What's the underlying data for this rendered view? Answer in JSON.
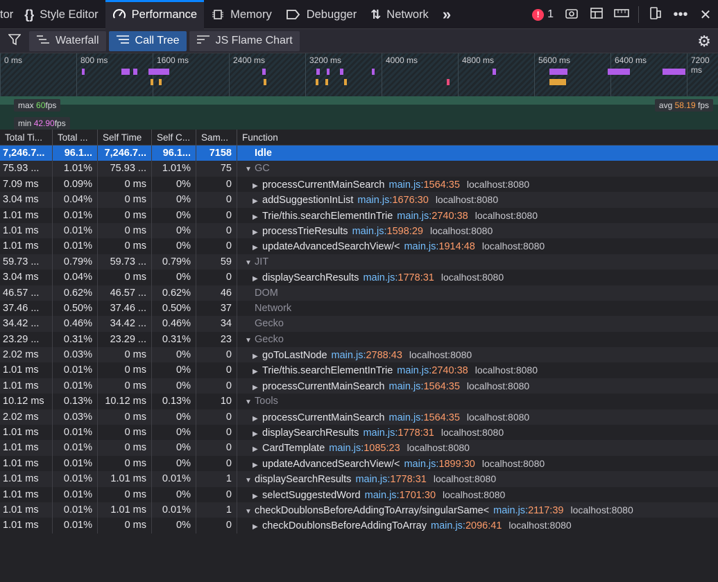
{
  "top_tabs": [
    {
      "label": "tor",
      "icon": "none"
    },
    {
      "label": "Style Editor",
      "icon": "braces-icon"
    },
    {
      "label": "Performance",
      "icon": "gauge-icon",
      "active": true
    },
    {
      "label": "Memory",
      "icon": "chip-icon"
    },
    {
      "label": "Debugger",
      "icon": "tag-icon"
    },
    {
      "label": "Network",
      "icon": "arrows-updown-icon"
    }
  ],
  "errors": {
    "count": "1"
  },
  "sub_tabs": [
    {
      "label": "Waterfall"
    },
    {
      "label": "Call Tree",
      "active": true
    },
    {
      "label": "JS Flame Chart"
    }
  ],
  "overview": {
    "ticks": [
      "0 ms",
      "800 ms",
      "1600 ms",
      "2400 ms",
      "3200 ms",
      "4000 ms",
      "4800 ms",
      "5600 ms",
      "6400 ms",
      "7200 ms"
    ],
    "fps_max_label": "max",
    "fps_max": "60",
    "fps_min_label": "min",
    "fps_min": "42.90",
    "fps_avg_label": "avg",
    "fps_avg": "58.19",
    "fps_unit": "fps"
  },
  "columns": [
    "Total Ti...",
    "Total ...",
    "Self Time",
    "Self C...",
    "Sam...",
    "Function"
  ],
  "rows": [
    {
      "total": "7,246.7...",
      "total_pct": "96.1...",
      "self": "7,246.7...",
      "self_pct": "96.1...",
      "samples": "7158",
      "name": "Idle",
      "category": true,
      "selected": true,
      "level": 0,
      "arrow": ""
    },
    {
      "total": "75.93 ...",
      "total_pct": "1.01%",
      "self": "75.93 ...",
      "self_pct": "1.01%",
      "samples": "75",
      "name": "GC",
      "category": true,
      "level": 0,
      "arrow": "▼"
    },
    {
      "total": "7.09 ms",
      "total_pct": "0.09%",
      "self": "0 ms",
      "self_pct": "0%",
      "samples": "0",
      "name": "processCurrentMainSearch",
      "file": "main.js",
      "line": "1564",
      "col": "35",
      "host": "localhost:8080",
      "level": 1,
      "arrow": "▶"
    },
    {
      "total": "3.04 ms",
      "total_pct": "0.04%",
      "self": "0 ms",
      "self_pct": "0%",
      "samples": "0",
      "name": "addSuggestionInList",
      "file": "main.js",
      "line": "1676",
      "col": "30",
      "host": "localhost:8080",
      "level": 1,
      "arrow": "▶"
    },
    {
      "total": "1.01 ms",
      "total_pct": "0.01%",
      "self": "0 ms",
      "self_pct": "0%",
      "samples": "0",
      "name": "Trie/this.searchElementInTrie",
      "file": "main.js",
      "line": "2740",
      "col": "38",
      "host": "localhost:8080",
      "level": 1,
      "arrow": "▶"
    },
    {
      "total": "1.01 ms",
      "total_pct": "0.01%",
      "self": "0 ms",
      "self_pct": "0%",
      "samples": "0",
      "name": "processTrieResults",
      "file": "main.js",
      "line": "1598",
      "col": "29",
      "host": "localhost:8080",
      "level": 1,
      "arrow": "▶"
    },
    {
      "total": "1.01 ms",
      "total_pct": "0.01%",
      "self": "0 ms",
      "self_pct": "0%",
      "samples": "0",
      "name": "updateAdvancedSearchView/<",
      "file": "main.js",
      "line": "1914",
      "col": "48",
      "host": "localhost:8080",
      "level": 1,
      "arrow": "▶"
    },
    {
      "total": "59.73 ...",
      "total_pct": "0.79%",
      "self": "59.73 ...",
      "self_pct": "0.79%",
      "samples": "59",
      "name": "JIT",
      "category": true,
      "level": 0,
      "arrow": "▼"
    },
    {
      "total": "3.04 ms",
      "total_pct": "0.04%",
      "self": "0 ms",
      "self_pct": "0%",
      "samples": "0",
      "name": "displaySearchResults",
      "file": "main.js",
      "line": "1778",
      "col": "31",
      "host": "localhost:8080",
      "level": 1,
      "arrow": "▶"
    },
    {
      "total": "46.57 ...",
      "total_pct": "0.62%",
      "self": "46.57 ...",
      "self_pct": "0.62%",
      "samples": "46",
      "name": "DOM",
      "category": true,
      "level": 0,
      "arrow": ""
    },
    {
      "total": "37.46 ...",
      "total_pct": "0.50%",
      "self": "37.46 ...",
      "self_pct": "0.50%",
      "samples": "37",
      "name": "Network",
      "category": true,
      "level": 0,
      "arrow": ""
    },
    {
      "total": "34.42 ...",
      "total_pct": "0.46%",
      "self": "34.42 ...",
      "self_pct": "0.46%",
      "samples": "34",
      "name": "Gecko",
      "category": true,
      "level": 0,
      "arrow": ""
    },
    {
      "total": "23.29 ...",
      "total_pct": "0.31%",
      "self": "23.29 ...",
      "self_pct": "0.31%",
      "samples": "23",
      "name": "Gecko",
      "category": true,
      "level": 0,
      "arrow": "▼"
    },
    {
      "total": "2.02 ms",
      "total_pct": "0.03%",
      "self": "0 ms",
      "self_pct": "0%",
      "samples": "0",
      "name": "goToLastNode",
      "file": "main.js",
      "line": "2788",
      "col": "43",
      "host": "localhost:8080",
      "level": 1,
      "arrow": "▶"
    },
    {
      "total": "1.01 ms",
      "total_pct": "0.01%",
      "self": "0 ms",
      "self_pct": "0%",
      "samples": "0",
      "name": "Trie/this.searchElementInTrie",
      "file": "main.js",
      "line": "2740",
      "col": "38",
      "host": "localhost:8080",
      "level": 1,
      "arrow": "▶"
    },
    {
      "total": "1.01 ms",
      "total_pct": "0.01%",
      "self": "0 ms",
      "self_pct": "0%",
      "samples": "0",
      "name": "processCurrentMainSearch",
      "file": "main.js",
      "line": "1564",
      "col": "35",
      "host": "localhost:8080",
      "level": 1,
      "arrow": "▶"
    },
    {
      "total": "10.12 ms",
      "total_pct": "0.13%",
      "self": "10.12 ms",
      "self_pct": "0.13%",
      "samples": "10",
      "name": "Tools",
      "category": true,
      "level": 0,
      "arrow": "▼"
    },
    {
      "total": "2.02 ms",
      "total_pct": "0.03%",
      "self": "0 ms",
      "self_pct": "0%",
      "samples": "0",
      "name": "processCurrentMainSearch",
      "file": "main.js",
      "line": "1564",
      "col": "35",
      "host": "localhost:8080",
      "level": 1,
      "arrow": "▶"
    },
    {
      "total": "1.01 ms",
      "total_pct": "0.01%",
      "self": "0 ms",
      "self_pct": "0%",
      "samples": "0",
      "name": "displaySearchResults",
      "file": "main.js",
      "line": "1778",
      "col": "31",
      "host": "localhost:8080",
      "level": 1,
      "arrow": "▶"
    },
    {
      "total": "1.01 ms",
      "total_pct": "0.01%",
      "self": "0 ms",
      "self_pct": "0%",
      "samples": "0",
      "name": "CardTemplate",
      "file": "main.js",
      "line": "1085",
      "col": "23",
      "host": "localhost:8080",
      "level": 1,
      "arrow": "▶"
    },
    {
      "total": "1.01 ms",
      "total_pct": "0.01%",
      "self": "0 ms",
      "self_pct": "0%",
      "samples": "0",
      "name": "updateAdvancedSearchView/<",
      "file": "main.js",
      "line": "1899",
      "col": "30",
      "host": "localhost:8080",
      "level": 1,
      "arrow": "▶"
    },
    {
      "total": "1.01 ms",
      "total_pct": "0.01%",
      "self": "1.01 ms",
      "self_pct": "0.01%",
      "samples": "1",
      "name": "displaySearchResults",
      "file": "main.js",
      "line": "1778",
      "col": "31",
      "host": "localhost:8080",
      "level": 0,
      "arrow": "▼"
    },
    {
      "total": "1.01 ms",
      "total_pct": "0.01%",
      "self": "0 ms",
      "self_pct": "0%",
      "samples": "0",
      "name": "selectSuggestedWord",
      "file": "main.js",
      "line": "1701",
      "col": "30",
      "host": "localhost:8080",
      "level": 1,
      "arrow": "▶"
    },
    {
      "total": "1.01 ms",
      "total_pct": "0.01%",
      "self": "1.01 ms",
      "self_pct": "0.01%",
      "samples": "1",
      "name": "checkDoublonsBeforeAddingToArray/singularSame<",
      "file": "main.js",
      "line": "2117",
      "col": "39",
      "host": "localhost:8080",
      "level": 0,
      "arrow": "▼"
    },
    {
      "total": "1.01 ms",
      "total_pct": "0.01%",
      "self": "0 ms",
      "self_pct": "0%",
      "samples": "0",
      "name": "checkDoublonsBeforeAddingToArray",
      "file": "main.js",
      "line": "2096",
      "col": "41",
      "host": "localhost:8080",
      "level": 1,
      "arrow": "▶"
    }
  ],
  "colors": {
    "accent": "#0a84ff",
    "selected_row": "#1f6cd1",
    "file": "#75bfff",
    "line": "#ff9c6a",
    "marker_purple": "#b05ce8",
    "marker_orange": "#e2a33c",
    "marker_pink": "#e84a7a"
  }
}
